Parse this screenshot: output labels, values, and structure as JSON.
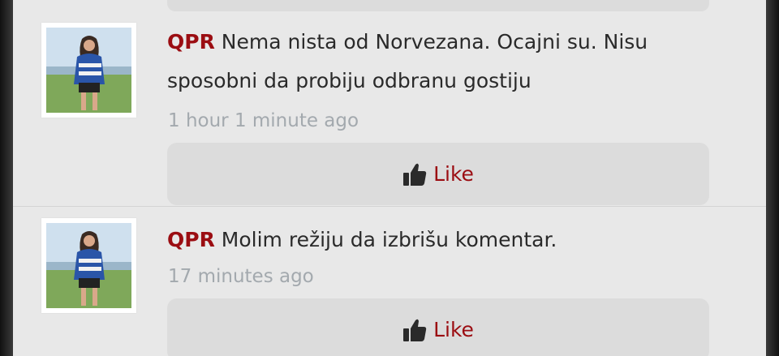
{
  "comments": [
    {
      "author": "QPR",
      "message": "Nema nista od Norvezana. Ocajni su. Nisu sposobni da probiju odbranu gostiju",
      "time": "1 hour 1 minute ago",
      "like_label": "Like",
      "avatar_icon": "user-avatar-photo"
    },
    {
      "author": "QPR",
      "message": "Molim režiju da izbrišu komentar.",
      "time": "17 minutes ago",
      "like_label": "Like",
      "avatar_icon": "user-avatar-photo"
    }
  ],
  "colors": {
    "author": "#9b0d12",
    "like": "#9b0d12",
    "timestamp": "#a3a9ae",
    "card_bg": "#e8e8e8",
    "button_bg": "#dcdcdc"
  }
}
